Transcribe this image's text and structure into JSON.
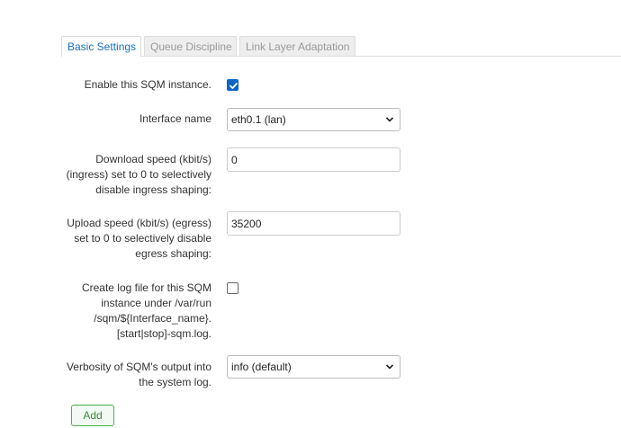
{
  "tabs": [
    {
      "label": "Basic Settings",
      "active": true
    },
    {
      "label": "Queue Discipline",
      "active": false
    },
    {
      "label": "Link Layer Adaptation",
      "active": false
    }
  ],
  "form": {
    "enable": {
      "label": "Enable this SQM instance.",
      "checked": true
    },
    "interface": {
      "label": "Interface name",
      "value": "eth0.1 (lan)"
    },
    "download": {
      "label_lines": [
        "Download speed (kbit/s)",
        "(ingress) set to 0 to selectively",
        "disable ingress shaping:"
      ],
      "value": "0"
    },
    "upload": {
      "label_lines": [
        "Upload speed (kbit/s) (egress)",
        "set to 0 to selectively disable",
        "egress shaping:"
      ],
      "value": "35200"
    },
    "logfile": {
      "label_lines": [
        "Create log file for this SQM",
        "instance under /var/run",
        "/sqm/${Interface_name}.",
        "[start|stop]-sqm.log."
      ],
      "checked": false
    },
    "verbosity": {
      "label_lines": [
        "Verbosity of SQM's output into",
        "the system log."
      ],
      "value": "info (default)"
    }
  },
  "actions": {
    "add_label": "Add"
  },
  "colors": {
    "active_tab_text": "#1a6fba",
    "checkbox_checked": "#0a66c2",
    "add_button_border": "#4cae4c",
    "add_button_text": "#3c8a3c"
  }
}
